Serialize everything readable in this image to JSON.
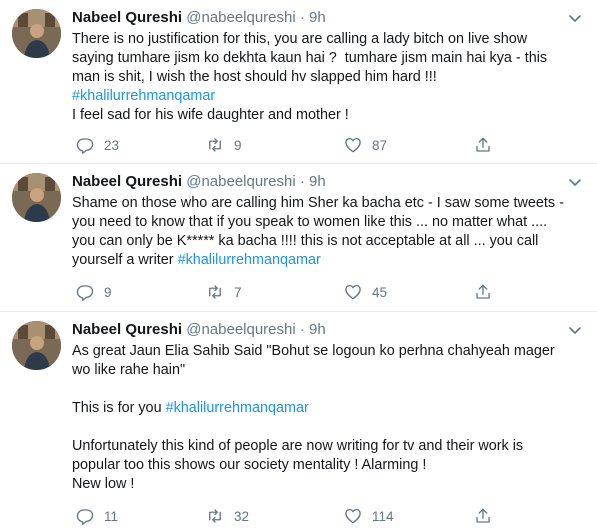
{
  "tweets": [
    {
      "name": "Nabeel Qureshi",
      "handle": "@nabeelqureshi",
      "time": "· 9h",
      "lines": [
        "There is no justification for this, you are calling a lady bitch on live show",
        "saying tumhare jism ko dekhta kaun hai ?  tumhare jism main hai kya - this",
        "man is shit, I wish the host should hv slapped him hard !!!"
      ],
      "hashtag": "#khalilurrehmanqamar",
      "after": "I feel sad for his wife daughter and mother !",
      "replies": "23",
      "retweets": "9",
      "likes": "87"
    },
    {
      "name": "Nabeel Qureshi",
      "handle": "@nabeelqureshi",
      "time": "· 9h",
      "lines": [
        "Shame on those who are calling him Sher ka bacha etc - I saw some tweets -",
        "you need to know that if you speak to women like this ... no matter what ....",
        "you can only be K***** ka bacha !!!! this is not acceptable at all ... you call"
      ],
      "last_prefix": "yourself a writer ",
      "hashtag": "#khalilurrehmanqamar",
      "replies": "9",
      "retweets": "7",
      "likes": "45"
    },
    {
      "name": "Nabeel Qureshi",
      "handle": "@nabeelqureshi",
      "time": "· 9h",
      "lines": [
        "As great Jaun Elia Sahib Said \"Bohut se logoun ko perhna chahyeah mager",
        "wo like rahe hain\""
      ],
      "mid_prefix": "This is for you ",
      "hashtag": "#khalilurrehmanqamar",
      "end_lines": [
        "Unfortunately this kind of people are now writing for tv and their work is",
        "popular too this shows our society mentality ! Alarming !",
        "New low !"
      ],
      "replies": "11",
      "retweets": "32",
      "likes": "114"
    }
  ],
  "icons": {
    "reply": "reply-icon",
    "retweet": "retweet-icon",
    "like": "heart-icon",
    "share": "share-icon",
    "menu": "chevron-down-icon"
  },
  "colors": {
    "hashtag": "#1b95e0",
    "muted": "#657786",
    "text": "#14171a",
    "divider": "#e6ecf0"
  }
}
